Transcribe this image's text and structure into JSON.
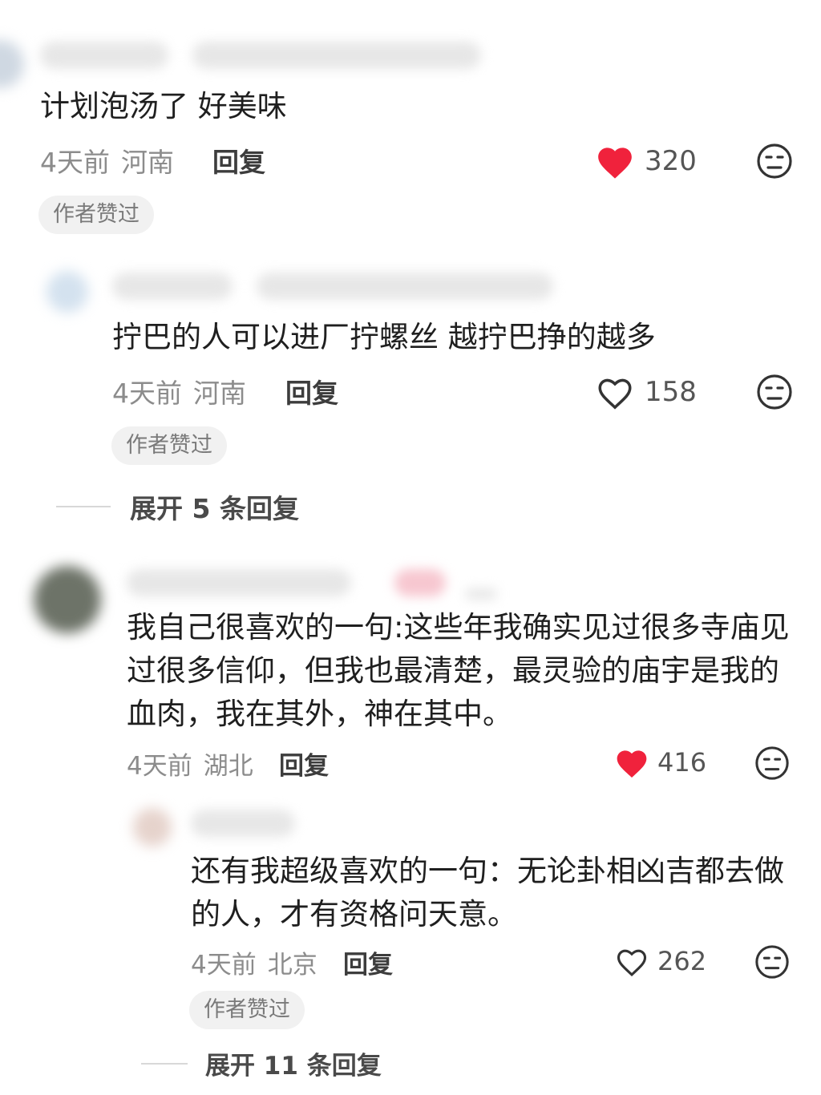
{
  "colors": {
    "liked": "#f0223c",
    "muted": "#8c8c8c",
    "badge_bg": "#f1f1f1"
  },
  "comments": [
    {
      "content": "计划泡汤了 好美味",
      "time": "4天前",
      "location": "河南",
      "reply_label": "回复",
      "likes": "320",
      "liked": true,
      "badge": "作者赞过"
    },
    {
      "content": "拧巴的人可以进厂拧螺丝 越拧巴挣的越多",
      "time": "4天前",
      "location": "河南",
      "reply_label": "回复",
      "likes": "158",
      "liked": false,
      "badge": "作者赞过",
      "expand": "展开 5 条回复"
    },
    {
      "content": "我自己很喜欢的一句:这些年我确实见过很多寺庙见过很多信仰，但我也最清楚，最灵验的庙宇是我的血肉，我在其外，神在其中。",
      "time": "4天前",
      "location": "湖北",
      "reply_label": "回复",
      "likes": "416",
      "liked": true
    },
    {
      "content": "还有我超级喜欢的一句：无论卦相凶吉都去做的人，才有资格问天意。",
      "time": "4天前",
      "location": "北京",
      "reply_label": "回复",
      "likes": "262",
      "liked": false,
      "badge": "作者赞过",
      "expand": "展开 11 条回复"
    }
  ],
  "icons": {
    "like": "heart-icon",
    "dislike": "unimpressed-face-icon"
  }
}
